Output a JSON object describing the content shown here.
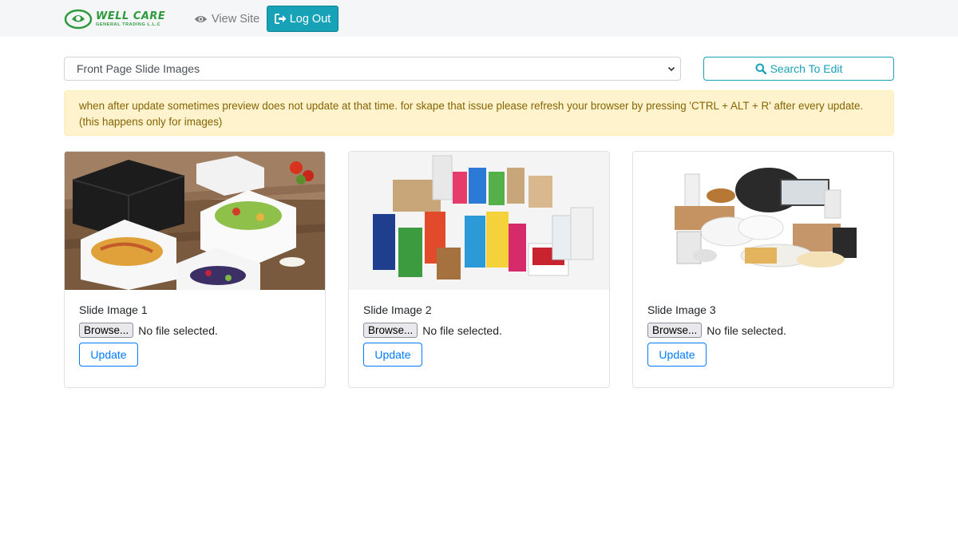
{
  "navbar": {
    "brand_name": "WELL CARE",
    "brand_sub": "GENERAL TRADING L.L.C",
    "view_site": "View Site",
    "logout": "Log Out"
  },
  "controls": {
    "select_value": "Front Page Slide Images",
    "search_button": "Search To Edit"
  },
  "alert": {
    "text": "when after update sometimes preview does not update at that time. for skape that issue please refresh your browser by pressing 'CTRL + ALT + R' after every update. (this happens only for images)"
  },
  "cards": [
    {
      "title": "Slide Image 1",
      "browse": "Browse...",
      "file_status": "No file selected.",
      "update": "Update"
    },
    {
      "title": "Slide Image 2",
      "browse": "Browse...",
      "file_status": "No file selected.",
      "update": "Update"
    },
    {
      "title": "Slide Image 3",
      "browse": "Browse...",
      "file_status": "No file selected.",
      "update": "Update"
    }
  ],
  "colors": {
    "info": "#17a2b8",
    "primary": "#007bff",
    "brand_green": "#2e9a3c",
    "alert_bg": "#fff3cd",
    "alert_text": "#856404"
  },
  "icons": {
    "view_site": "eye-icon",
    "logout": "sign-out-icon",
    "search": "search-icon",
    "select": "chevron-down-icon"
  }
}
